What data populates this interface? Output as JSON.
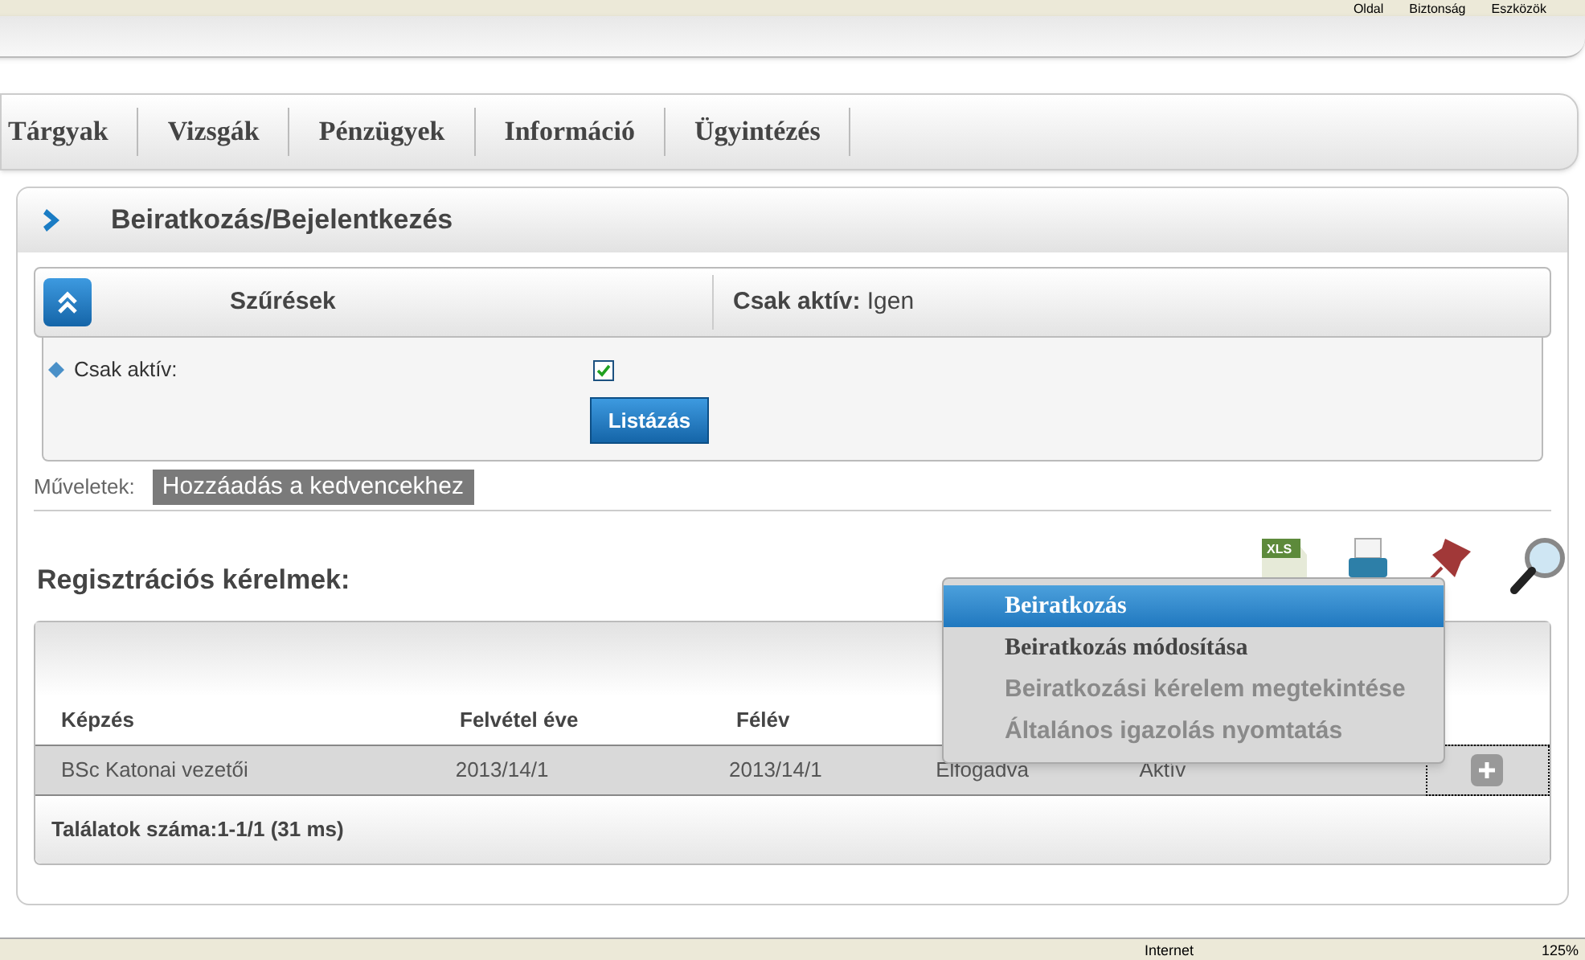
{
  "browser_toolbar": {
    "items": [
      "Oldal",
      "Biztonság",
      "Eszközök"
    ]
  },
  "nav": {
    "items": [
      {
        "label": "Tárgyak",
        "selected": false
      },
      {
        "label": "Vizsgák",
        "selected": false
      },
      {
        "label": "Pénzügyek",
        "selected": false
      },
      {
        "label": "Információ",
        "selected": false
      },
      {
        "label": "Ügyintézés",
        "selected": false
      }
    ]
  },
  "page_title": "Beiratkozás/Bejelentkezés",
  "filters": {
    "title": "Szűrések",
    "summary_label": "Csak aktív:",
    "summary_value": "Igen",
    "expanded": true,
    "fields": [
      {
        "label": "Csak aktív:",
        "checked": true
      }
    ],
    "button": "Listázás"
  },
  "operations": {
    "label": "Műveletek:",
    "link": "Hozzáadás a kedvencekhez"
  },
  "section_title": "Regisztrációs kérelmek:",
  "export_icon_label": "XLS",
  "context_menu": [
    {
      "label": "Beiratkozás",
      "selected": true,
      "disabled": false
    },
    {
      "label": "Beiratkozás módosítása",
      "selected": false,
      "disabled": false
    },
    {
      "label": "Beiratkozási kérelem megtekintése",
      "selected": false,
      "disabled": true
    },
    {
      "label": "Általános igazolás nyomtatás",
      "selected": false,
      "disabled": true
    }
  ],
  "table": {
    "columns": [
      "Képzés",
      "Felvétel éve",
      "Félév"
    ],
    "rows": [
      {
        "cells": [
          "BSc Katonai vezetői",
          "2013/14/1",
          "2013/14/1",
          "Elfogadva",
          "Aktív"
        ],
        "selected": true
      }
    ],
    "footer": "Találatok száma:1-1/1 (31 ms)"
  },
  "status_bar": {
    "zone": "Internet",
    "zoom": "125%"
  }
}
